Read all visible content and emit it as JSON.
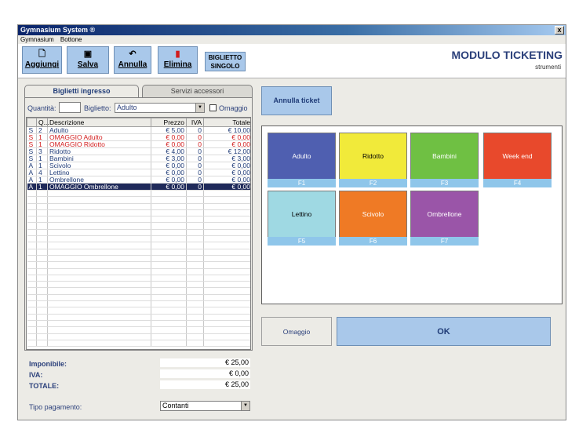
{
  "window": {
    "title": "Gymnasium System ®",
    "close": "x"
  },
  "menu": [
    "Gymnasium",
    "Bottone"
  ],
  "toolbar": [
    {
      "label": "Aggiungi",
      "icon": "document-icon"
    },
    {
      "label": "Salva",
      "icon": "save-icon"
    },
    {
      "label": "Annulla",
      "icon": "undo-icon"
    },
    {
      "label": "Elimina",
      "icon": "trash-icon"
    }
  ],
  "single_ticket": [
    "BIGLIETTO",
    "SINGOLO"
  ],
  "module": {
    "title": "MODULO TICKETING",
    "subtitle": "strumenti"
  },
  "tabs": {
    "active": "Biglietti ingresso",
    "inactive": "Servizi accessori"
  },
  "form": {
    "quantity_label": "Quantità:",
    "ticket_label": "Biglietto:",
    "ticket_value": "Adulto",
    "omaggio_label": "Omaggio"
  },
  "grid": {
    "headers": [
      "",
      "Q...",
      "Descrizione",
      "Prezzo",
      "IVA",
      "Totale"
    ],
    "rows": [
      {
        "t": "S",
        "q": "2",
        "desc": "Adulto",
        "price": "€ 5,00",
        "iva": "0",
        "total": "€ 10,00",
        "style": "blue"
      },
      {
        "t": "S",
        "q": "1",
        "desc": "OMAGGIO Adulto",
        "price": "€ 0,00",
        "iva": "0",
        "total": "€ 0,00",
        "style": "red"
      },
      {
        "t": "S",
        "q": "1",
        "desc": "OMAGGIO Ridotto",
        "price": "€ 0,00",
        "iva": "0",
        "total": "€ 0,00",
        "style": "red"
      },
      {
        "t": "S",
        "q": "3",
        "desc": "Ridotto",
        "price": "€ 4,00",
        "iva": "0",
        "total": "€ 12,00",
        "style": "blue"
      },
      {
        "t": "S",
        "q": "1",
        "desc": "Bambini",
        "price": "€ 3,00",
        "iva": "0",
        "total": "€ 3,00",
        "style": "blue"
      },
      {
        "t": "A",
        "q": "1",
        "desc": "Scivolo",
        "price": "€ 0,00",
        "iva": "0",
        "total": "€ 0,00",
        "style": "blue"
      },
      {
        "t": "A",
        "q": "4",
        "desc": "Lettino",
        "price": "€ 0,00",
        "iva": "0",
        "total": "€ 0,00",
        "style": "blue"
      },
      {
        "t": "A",
        "q": "1",
        "desc": "Ombrellone",
        "price": "€ 0,00",
        "iva": "0",
        "total": "€ 0,00",
        "style": "blue"
      },
      {
        "t": "A",
        "q": "1",
        "desc": "OMAGGIO Ombrellone",
        "price": "€ 0,00",
        "iva": "0",
        "total": "€ 0,00",
        "style": "selected"
      }
    ]
  },
  "totals": {
    "imponibile_label": "Imponibile:",
    "imponibile": "€ 25,00",
    "iva_label": "IVA:",
    "iva": "€ 0,00",
    "totale_label": "TOTALE:",
    "totale": "€ 25,00",
    "payment_label": "Tipo pagamento:",
    "payment_value": "Contanti"
  },
  "annulla_ticket": "Annulla ticket",
  "tickets": [
    {
      "name": "Adulto",
      "key": "F1",
      "color": "#4f5fb0",
      "text": "#ffffff"
    },
    {
      "name": "Ridotto",
      "key": "F2",
      "color": "#f1ea3a",
      "text": "#000000"
    },
    {
      "name": "Bambini",
      "key": "F3",
      "color": "#6fc043",
      "text": "#ffffff"
    },
    {
      "name": "Week end",
      "key": "F4",
      "color": "#e8492c",
      "text": "#ffffff"
    },
    {
      "name": "Lettino",
      "key": "F5",
      "color": "#9fd9e3",
      "text": "#000000"
    },
    {
      "name": "Scivolo",
      "key": "F6",
      "color": "#ef7a25",
      "text": "#ffffff"
    },
    {
      "name": "Ombrellone",
      "key": "F7",
      "color": "#9a55a8",
      "text": "#ffffff"
    }
  ],
  "omaggio_button": "Omaggio",
  "ok_button": "OK"
}
